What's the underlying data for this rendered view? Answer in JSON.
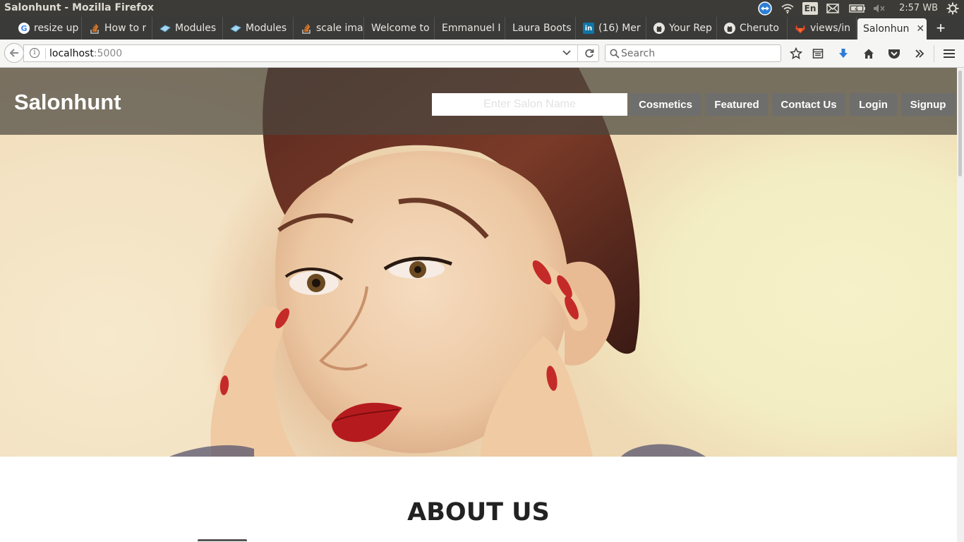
{
  "os": {
    "window_title": "Salonhunt - Mozilla Firefox",
    "keyboard_layout": "En",
    "clock": "2:57 WB",
    "tray_icons": [
      "teamviewer-icon",
      "wifi-icon",
      "keyboard-layout-indicator",
      "mail-icon",
      "battery-icon",
      "volume-muted-icon",
      "settings-gear-icon"
    ]
  },
  "tabs": [
    {
      "label": "resize up",
      "icon": "google-icon"
    },
    {
      "label": "How to r",
      "icon": "stackoverflow-icon"
    },
    {
      "label": "Modules",
      "icon": "module-icon"
    },
    {
      "label": "Modules",
      "icon": "module-icon"
    },
    {
      "label": "scale ima",
      "icon": "stackoverflow-icon"
    },
    {
      "label": "Welcome to",
      "icon": ""
    },
    {
      "label": "Emmanuel I",
      "icon": ""
    },
    {
      "label": "Laura Boots",
      "icon": ""
    },
    {
      "label": "(16) Mer",
      "icon": "linkedin-icon"
    },
    {
      "label": "Your Rep",
      "icon": "github-icon"
    },
    {
      "label": "Cheruto",
      "icon": "github-icon"
    },
    {
      "label": "views/in",
      "icon": "gitlab-icon"
    },
    {
      "label": "Salonhun",
      "icon": "",
      "active": true
    }
  ],
  "navbar": {
    "url_host": "localhost",
    "url_port": ":5000",
    "search_placeholder": "Search",
    "toolbar_icons": [
      "bookmark-star-icon",
      "reading-list-icon",
      "downloads-icon",
      "home-icon",
      "pocket-icon",
      "overflow-chevrons-icon",
      "hamburger-menu-icon"
    ]
  },
  "site": {
    "brand": "Salonhunt",
    "search_placeholder": "Enter Salon Name",
    "nav": [
      "Cosmetics",
      "Featured",
      "Contact Us",
      "Login",
      "Signup"
    ],
    "about_heading": "ABOUT US"
  },
  "colors": {
    "header_overlay": "#4b463e",
    "nav_button_bg": "#6e6e6c",
    "os_bar": "#3c3b37"
  }
}
